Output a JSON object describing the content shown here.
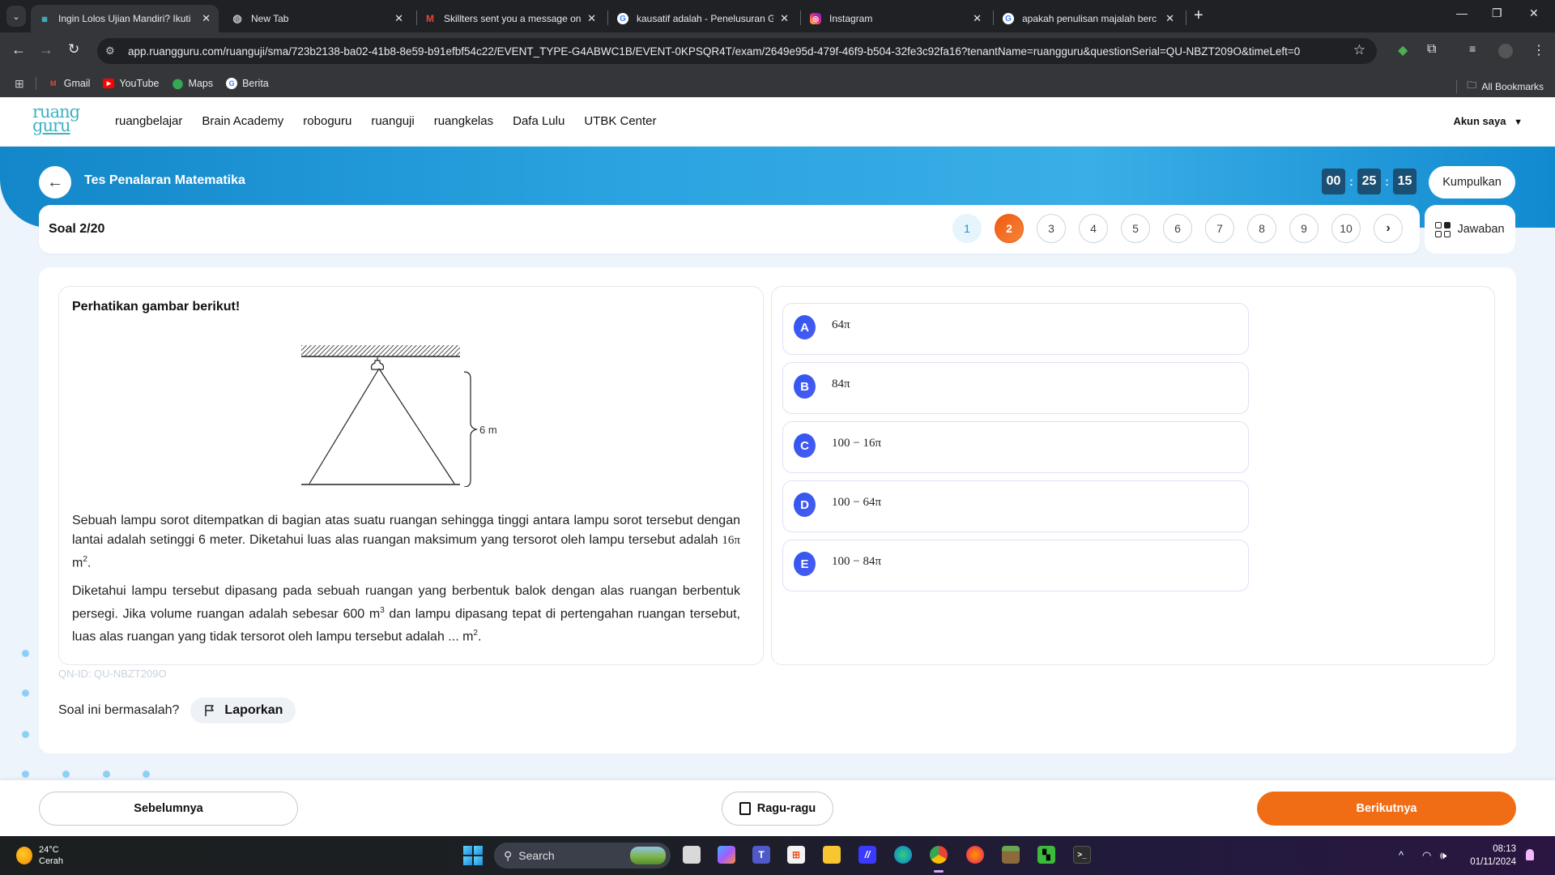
{
  "browser": {
    "tabs": [
      {
        "title": "Ingin Lolos Ujian Mandiri? Ikuti",
        "icon": "ruangguru-favicon",
        "active": true
      },
      {
        "title": "New Tab",
        "icon": "globe-icon",
        "active": false
      },
      {
        "title": "Skillters sent you a message on",
        "icon": "gmail-icon",
        "active": false
      },
      {
        "title": "kausatif adalah - Penelusuran G",
        "icon": "google-icon",
        "active": false
      },
      {
        "title": "Instagram",
        "icon": "instagram-icon",
        "active": false
      },
      {
        "title": "apakah penulisan majalah berc",
        "icon": "google-icon",
        "active": false
      }
    ],
    "new_tab_label": "+",
    "url": "app.ruangguru.com/ruanguji/sma/723b2138-ba02-41b8-8e59-b91efbf54c22/EVENT_TYPE-G4ABWC1B/EVENT-0KPSQR4T/exam/2649e95d-479f-46f9-b504-32fe3c92fa16?tenantName=ruangguru&questionSerial=QU-NBZT209O&timeLeft=0",
    "bookmarks": [
      {
        "label": "Gmail",
        "icon": "gmail-icon"
      },
      {
        "label": "YouTube",
        "icon": "youtube-icon"
      },
      {
        "label": "Maps",
        "icon": "maps-icon"
      },
      {
        "label": "Berita",
        "icon": "google-news-icon"
      }
    ],
    "all_bookmarks_label": "All Bookmarks"
  },
  "site": {
    "logo_line1": "ruang",
    "logo_line2": "guru",
    "nav": [
      "ruangbelajar",
      "Brain Academy",
      "roboguru",
      "ruanguji",
      "ruangkelas",
      "Dafa Lulu",
      "UTBK Center"
    ],
    "account_label": "Akun saya",
    "account_caret": "▼"
  },
  "exam": {
    "title": "Tes Penalaran Matematika",
    "timer": {
      "hours": "00",
      "minutes": "25",
      "seconds": "15",
      "separator": ":"
    },
    "submit_label": "Kumpulkan",
    "question_counter": "Soal 2/20",
    "question_numbers": [
      {
        "num": "1",
        "state": "answered"
      },
      {
        "num": "2",
        "state": "current"
      },
      {
        "num": "3",
        "state": "default"
      },
      {
        "num": "4",
        "state": "default"
      },
      {
        "num": "5",
        "state": "default"
      },
      {
        "num": "6",
        "state": "default"
      },
      {
        "num": "7",
        "state": "default"
      },
      {
        "num": "8",
        "state": "default"
      },
      {
        "num": "9",
        "state": "default"
      },
      {
        "num": "10",
        "state": "default"
      }
    ],
    "next_page_glyph": "›",
    "answers_button_label": "Jawaban"
  },
  "question": {
    "intro": "Perhatikan gambar berikut!",
    "figure_label": "6 m",
    "p1_a": "Sebuah lampu sorot ditempatkan di bagian atas suatu ruangan sehingga tinggi antara lampu sorot tersebut dengan lantai adalah setinggi 6 meter. Diketahui luas alas ruangan maksimum yang tersorot oleh lampu tersebut adalah ",
    "p1_math": "16π",
    "p1_unit": " m",
    "p1_sup": "2",
    "p1_end": ".",
    "p2_a": "Diketahui lampu tersebut dipasang pada sebuah ruangan yang berbentuk balok dengan alas ruangan berbentuk persegi. Jika volume ruangan adalah sebesar 600 m",
    "p2_sup1": "3",
    "p2_b": " dan lampu dipasang tepat di pertengahan ruangan tersebut, luas alas ruangan yang tidak tersorot oleh lampu tersebut adalah ... m",
    "p2_sup2": "2",
    "p2_end": ".",
    "options": [
      {
        "letter": "A",
        "value": "64π"
      },
      {
        "letter": "B",
        "value": "84π"
      },
      {
        "letter": "C",
        "value": "100 − 16π"
      },
      {
        "letter": "D",
        "value": "100 − 64π"
      },
      {
        "letter": "E",
        "value": "100 − 84π"
      }
    ],
    "qn_id": "QN-ID: QU-NBZT209O",
    "report_prompt": "Soal ini bermasalah?",
    "report_label": "Laporkan"
  },
  "footer_nav": {
    "prev_label": "Sebelumnya",
    "doubt_label": "Ragu-ragu",
    "next_label": "Berikutnya"
  },
  "taskbar": {
    "temperature": "24°C",
    "weather": "Cerah",
    "search_label": "Search",
    "time": "08:13",
    "date": "01/11/2024"
  },
  "colors": {
    "accent_orange": "#f06d15",
    "banner_blue": "#2aa3e0",
    "option_blue": "#3a57f1",
    "logo_teal": "#3fb2c1"
  }
}
